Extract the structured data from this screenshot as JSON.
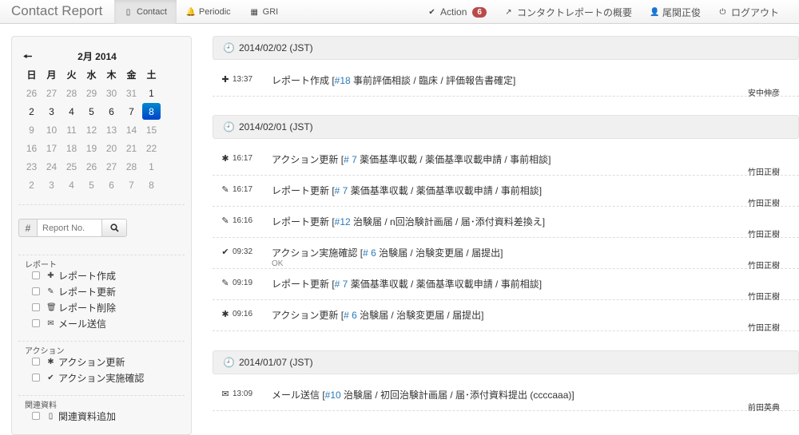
{
  "nav": {
    "brand": "Contact Report",
    "tabs": [
      {
        "label": "Contact",
        "icon": "file-icon",
        "glyph": "▯"
      },
      {
        "label": "Periodic",
        "icon": "bell-icon",
        "glyph": "🔔"
      },
      {
        "label": "GRI",
        "icon": "grid-icon",
        "glyph": "▦"
      }
    ],
    "action_label": "Action",
    "action_count": "6",
    "overview_label": "コンタクトレポートの概要",
    "user_label": "尾関正俊",
    "logout_label": "ログアウト"
  },
  "calendar": {
    "prev_glyph": "🠔",
    "title": "2月 2014",
    "weekdays": [
      "日",
      "月",
      "火",
      "水",
      "木",
      "金",
      "土"
    ],
    "days": [
      {
        "d": "26",
        "m": "other"
      },
      {
        "d": "27",
        "m": "other"
      },
      {
        "d": "28",
        "m": "other"
      },
      {
        "d": "29",
        "m": "other"
      },
      {
        "d": "30",
        "m": "other"
      },
      {
        "d": "31",
        "m": "other"
      },
      {
        "d": "1",
        "m": "cur"
      },
      {
        "d": "2",
        "m": "cur"
      },
      {
        "d": "3",
        "m": "cur"
      },
      {
        "d": "4",
        "m": "cur"
      },
      {
        "d": "5",
        "m": "cur"
      },
      {
        "d": "6",
        "m": "cur"
      },
      {
        "d": "7",
        "m": "cur"
      },
      {
        "d": "8",
        "m": "sel"
      },
      {
        "d": "9",
        "m": "other"
      },
      {
        "d": "10",
        "m": "other"
      },
      {
        "d": "11",
        "m": "other"
      },
      {
        "d": "12",
        "m": "other"
      },
      {
        "d": "13",
        "m": "other"
      },
      {
        "d": "14",
        "m": "other"
      },
      {
        "d": "15",
        "m": "other"
      },
      {
        "d": "16",
        "m": "other"
      },
      {
        "d": "17",
        "m": "other"
      },
      {
        "d": "18",
        "m": "other"
      },
      {
        "d": "19",
        "m": "other"
      },
      {
        "d": "20",
        "m": "other"
      },
      {
        "d": "21",
        "m": "other"
      },
      {
        "d": "22",
        "m": "other"
      },
      {
        "d": "23",
        "m": "other"
      },
      {
        "d": "24",
        "m": "other"
      },
      {
        "d": "25",
        "m": "other"
      },
      {
        "d": "26",
        "m": "other"
      },
      {
        "d": "27",
        "m": "other"
      },
      {
        "d": "28",
        "m": "other"
      },
      {
        "d": "1",
        "m": "other"
      },
      {
        "d": "2",
        "m": "other"
      },
      {
        "d": "3",
        "m": "other"
      },
      {
        "d": "4",
        "m": "other"
      },
      {
        "d": "5",
        "m": "other"
      },
      {
        "d": "6",
        "m": "other"
      },
      {
        "d": "7",
        "m": "other"
      },
      {
        "d": "8",
        "m": "other"
      }
    ]
  },
  "search": {
    "hash": "#",
    "placeholder": "Report No."
  },
  "filters": {
    "report_title": "レポート",
    "report_create": "レポート作成",
    "report_update": "レポート更新",
    "report_delete": "レポート削除",
    "mail_send": "メール送信",
    "action_title": "アクション",
    "action_update": "アクション更新",
    "action_confirm": "アクション実施確認",
    "related_title": "関連資料",
    "related_add": "関連資料追加"
  },
  "groups": [
    {
      "date": "2014/02/02 (JST)",
      "entries": [
        {
          "icon": "plus-icon",
          "glyph": "✚",
          "time": "13:37",
          "text": "レポート作成 [",
          "link": "#18",
          "detail": " 事前評価相談 / 臨床 / 評価報告書確定]",
          "author": "安中伸彦",
          "note": ""
        }
      ]
    },
    {
      "date": "2014/02/01 (JST)",
      "entries": [
        {
          "icon": "asterisk-icon",
          "glyph": "✱",
          "time": "16:17",
          "text": "アクション更新 [",
          "link": "# 7",
          "detail": " 薬価基準収載 / 薬価基準収載申請 / 事前相談]",
          "author": "竹田正樹",
          "note": ""
        },
        {
          "icon": "pencil-icon",
          "glyph": "✎",
          "time": "16:17",
          "text": "レポート更新 [",
          "link": "# 7",
          "detail": " 薬価基準収載 / 薬価基準収載申請 / 事前相談]",
          "author": "竹田正樹",
          "note": ""
        },
        {
          "icon": "pencil-icon",
          "glyph": "✎",
          "time": "16:16",
          "text": "レポート更新 [",
          "link": "#12",
          "detail": " 治験届 / n回治験計画届 / 届･添付資料差換え]",
          "author": "竹田正樹",
          "note": ""
        },
        {
          "icon": "check-icon",
          "glyph": "✔",
          "time": "09:32",
          "text": "アクション実施確認 [",
          "link": "# 6",
          "detail": " 治験届 / 治験変更届 / 届提出]",
          "author": "竹田正樹",
          "note": "OK"
        },
        {
          "icon": "pencil-icon",
          "glyph": "✎",
          "time": "09:19",
          "text": "レポート更新 [",
          "link": "# 7",
          "detail": " 薬価基準収載 / 薬価基準収載申請 / 事前相談]",
          "author": "竹田正樹",
          "note": ""
        },
        {
          "icon": "asterisk-icon",
          "glyph": "✱",
          "time": "09:16",
          "text": "アクション更新 [",
          "link": "# 6",
          "detail": " 治験届 / 治験変更届 / 届提出]",
          "author": "竹田正樹",
          "note": ""
        }
      ]
    },
    {
      "date": "2014/01/07 (JST)",
      "entries": [
        {
          "icon": "envelope-icon",
          "glyph": "✉",
          "time": "13:09",
          "text": "メール送信 [",
          "link": "#10",
          "detail": " 治験届 / 初回治験計画届 / 届･添付資料提出 (ccccaaa)]",
          "author": "前田英典",
          "note": ""
        }
      ]
    }
  ]
}
